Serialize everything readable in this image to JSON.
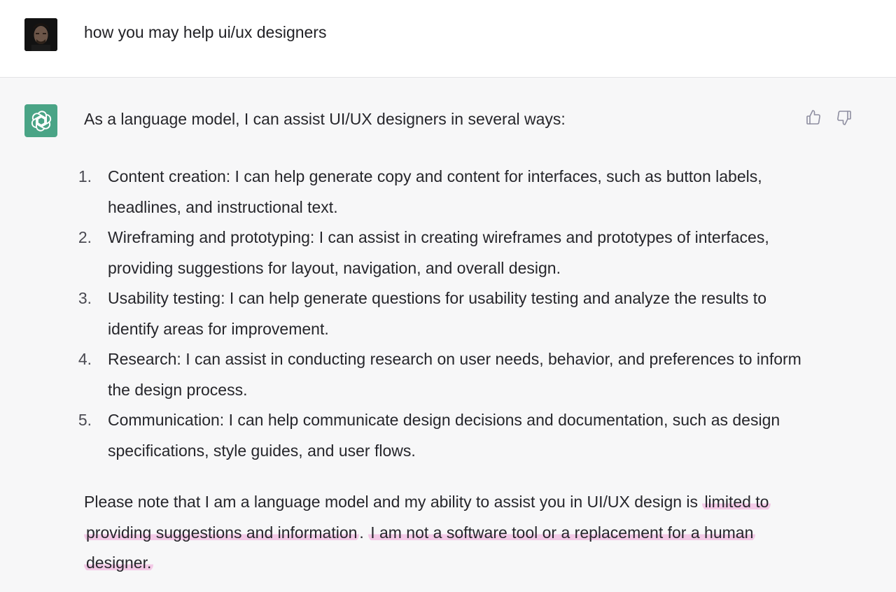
{
  "user": {
    "message": "how you may help ui/ux designers"
  },
  "assistant": {
    "intro": "As a language model, I can assist UI/UX designers in several ways:",
    "items": [
      {
        "number": "1.",
        "text": "Content creation: I can help generate copy and content for interfaces, such as button labels, headlines, and instructional text."
      },
      {
        "number": "2.",
        "text": "Wireframing and prototyping: I can assist in creating wireframes and prototypes of interfaces, providing suggestions for layout, navigation, and overall design."
      },
      {
        "number": "3.",
        "text": "Usability testing: I can help generate questions for usability testing and analyze the results to identify areas for improvement."
      },
      {
        "number": "4.",
        "text": "Research: I can assist in conducting research on user needs, behavior, and preferences to inform the design process."
      },
      {
        "number": "5.",
        "text": "Communication: I can help communicate design decisions and documentation, such as design specifications, style guides, and user flows."
      }
    ],
    "note_plain": "Please note that I am a language model and my ability to assist you in UI/UX design is ",
    "note_highlight_1": "limited to providing suggestions and information",
    "note_mid": ". ",
    "note_highlight_2": "I am not a software tool or a replacement for a human designer.",
    "feedback": {
      "thumbs_up_icon": "thumbs-up-icon",
      "thumbs_down_icon": "thumbs-down-icon"
    }
  },
  "colors": {
    "bot_avatar_bg": "#4aa486",
    "highlight": "#f3c9e6",
    "assistant_bg": "#f7f7f8",
    "user_bg": "#ffffff"
  }
}
